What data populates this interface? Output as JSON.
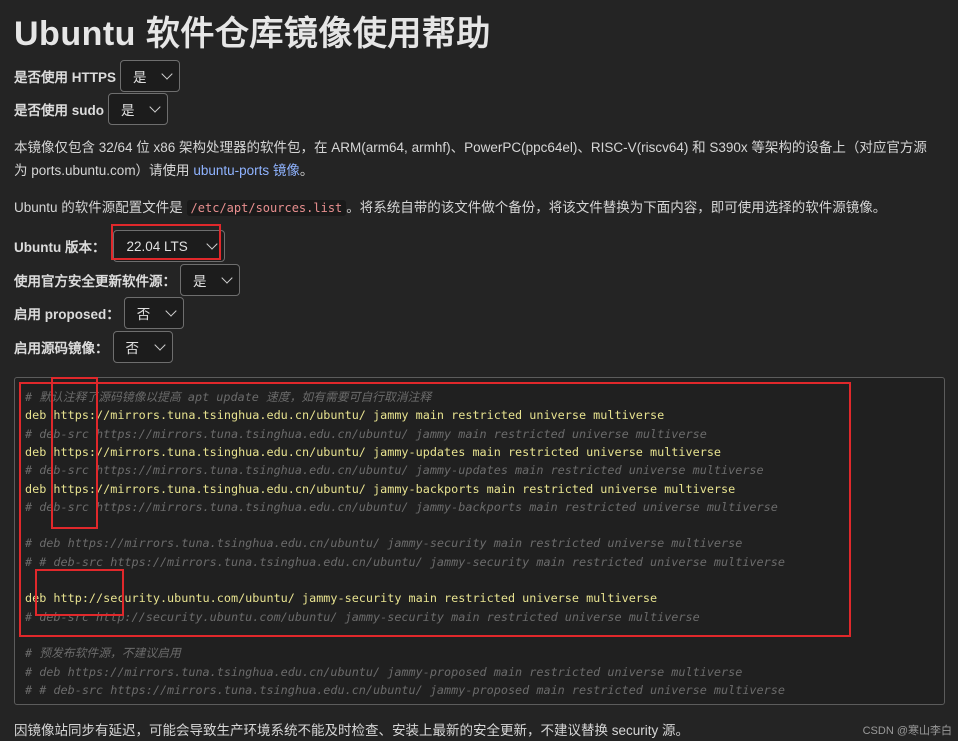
{
  "title": "Ubuntu 软件仓库镜像使用帮助",
  "options": {
    "https_label": "是否使用 HTTPS",
    "https_value": "是",
    "sudo_label": "是否使用 sudo",
    "sudo_value": "是",
    "version_label": "Ubuntu 版本：",
    "version_value": "22.04 LTS",
    "security_label": "使用官方安全更新软件源：",
    "security_value": "是",
    "proposed_label": "启用 proposed：",
    "proposed_value": "否",
    "source_label": "启用源码镜像：",
    "source_value": "否"
  },
  "intro": {
    "line1": "本镜像仅包含 32/64 位 x86 架构处理器的软件包，在 ARM(arm64, armhf)、PowerPC(ppc64el)、RISC-V(riscv64) 和 S390x 等架构的设备上（对应官方源",
    "line2_prefix": "为 ports.ubuntu.com）请使用 ",
    "line2_link": "ubuntu-ports 镜像",
    "line2_suffix": "。"
  },
  "config": {
    "prefix": "Ubuntu 的软件源配置文件是 ",
    "path": "/etc/apt/sources.list",
    "suffix": "。将系统自带的该文件做个备份，将该文件替换为下面内容，即可使用选择的软件源镜像。"
  },
  "code_lines": [
    {
      "text": "# 默认注释了源码镜像以提高 apt update 速度，如有需要可自行取消注释",
      "kind": "comment"
    },
    {
      "text": "deb https://mirrors.tuna.tsinghua.edu.cn/ubuntu/ jammy main restricted universe multiverse",
      "kind": "code"
    },
    {
      "text": "# deb-src https://mirrors.tuna.tsinghua.edu.cn/ubuntu/ jammy main restricted universe multiverse",
      "kind": "comment"
    },
    {
      "text": "deb https://mirrors.tuna.tsinghua.edu.cn/ubuntu/ jammy-updates main restricted universe multiverse",
      "kind": "code"
    },
    {
      "text": "# deb-src https://mirrors.tuna.tsinghua.edu.cn/ubuntu/ jammy-updates main restricted universe multiverse",
      "kind": "comment"
    },
    {
      "text": "deb https://mirrors.tuna.tsinghua.edu.cn/ubuntu/ jammy-backports main restricted universe multiverse",
      "kind": "code"
    },
    {
      "text": "# deb-src https://mirrors.tuna.tsinghua.edu.cn/ubuntu/ jammy-backports main restricted universe multiverse",
      "kind": "comment"
    },
    {
      "text": "",
      "kind": "blank"
    },
    {
      "text": "# deb https://mirrors.tuna.tsinghua.edu.cn/ubuntu/ jammy-security main restricted universe multiverse",
      "kind": "comment"
    },
    {
      "text": "# # deb-src https://mirrors.tuna.tsinghua.edu.cn/ubuntu/ jammy-security main restricted universe multiverse",
      "kind": "comment"
    },
    {
      "text": "",
      "kind": "blank"
    },
    {
      "text": "deb http://security.ubuntu.com/ubuntu/ jammy-security main restricted universe multiverse",
      "kind": "code"
    },
    {
      "text": "# deb-src http://security.ubuntu.com/ubuntu/ jammy-security main restricted universe multiverse",
      "kind": "comment"
    },
    {
      "text": "",
      "kind": "blank"
    },
    {
      "text": "# 预发布软件源，不建议启用",
      "kind": "comment"
    },
    {
      "text": "# deb https://mirrors.tuna.tsinghua.edu.cn/ubuntu/ jammy-proposed main restricted universe multiverse",
      "kind": "comment"
    },
    {
      "text": "# # deb-src https://mirrors.tuna.tsinghua.edu.cn/ubuntu/ jammy-proposed main restricted universe multiverse",
      "kind": "comment"
    }
  ],
  "footer": "因镜像站同步有延迟，可能会导致生产环境系统不能及时检查、安装上最新的安全更新，不建议替换 security 源。",
  "watermark": "CSDN @寒山李白",
  "colors": {
    "highlight": "#e0282b",
    "code": "#e7e28f",
    "link": "#8fb3ff"
  }
}
